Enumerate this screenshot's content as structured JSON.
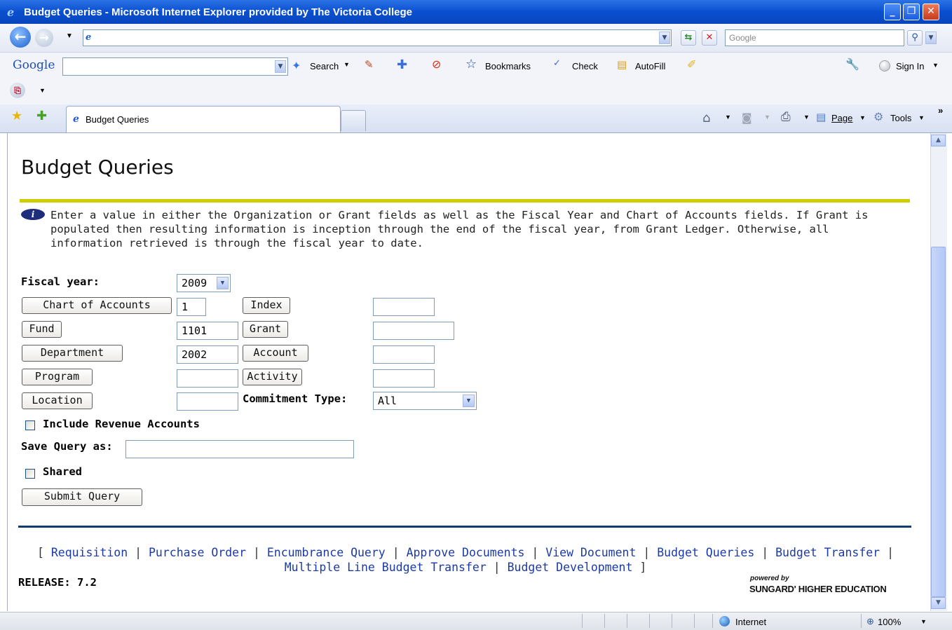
{
  "window": {
    "title": "Budget Queries - Microsoft Internet Explorer provided by The Victoria College",
    "controls": [
      "_",
      "❐",
      "✕"
    ]
  },
  "address_bar": {
    "search_placeholder": "Google"
  },
  "google_toolbar": {
    "logo": "Google",
    "search": "Search",
    "bookmarks": "Bookmarks",
    "check": "Check",
    "autofill": "AutoFill",
    "sign_in": "Sign In"
  },
  "tabs": {
    "active_label": "Budget Queries",
    "page_menu": "Page",
    "tools_menu": "Tools"
  },
  "page": {
    "heading": "Budget Queries",
    "info": "Enter a value in either the Organization or Grant fields as well as the Fiscal Year and Chart of Accounts fields. If Grant is populated then resulting information is inception through the end of the fiscal year, from Grant Ledger. Otherwise, all information retrieved is through the fiscal year to date.",
    "form": {
      "fiscal_year_label": "Fiscal year:",
      "fiscal_year_value": "2009",
      "chart_of_accounts_button": "Chart of Accounts",
      "chart_of_accounts_value": "1",
      "index_button": "Index",
      "index_value": "",
      "fund_button": "Fund",
      "fund_value": "1101",
      "grant_button": "Grant",
      "grant_value": "",
      "department_button": "Department",
      "department_value": "2002",
      "account_button": "Account",
      "account_value": "",
      "program_button": "Program",
      "program_value": "",
      "activity_button": "Activity",
      "activity_value": "",
      "location_button": "Location",
      "location_value": "",
      "commitment_type_label": "Commitment Type:",
      "commitment_type_value": "All",
      "include_revenue_label": "Include Revenue Accounts",
      "include_revenue_checked": false,
      "save_query_label": "Save Query as:",
      "save_query_value": "",
      "shared_label": "Shared",
      "shared_checked": false,
      "submit_button": "Submit Query"
    },
    "footer_links": [
      "Requisition",
      "Purchase Order",
      "Encumbrance Query",
      "Approve Documents",
      "View Document",
      "Budget Queries",
      "Budget Transfer",
      "Multiple Line Budget Transfer",
      "Budget Development"
    ],
    "release": "RELEASE: 7.2",
    "powered_by": "powered by",
    "sungard": "SUNGARD' HIGHER EDUCATION"
  },
  "status_bar": {
    "zone": "Internet",
    "zoom": "100%"
  },
  "colors": {
    "title_bar": "#0a4fcf",
    "heading_rule": "#cfcf00",
    "footer_rule": "#113c70",
    "link": "#1b3aa6"
  }
}
